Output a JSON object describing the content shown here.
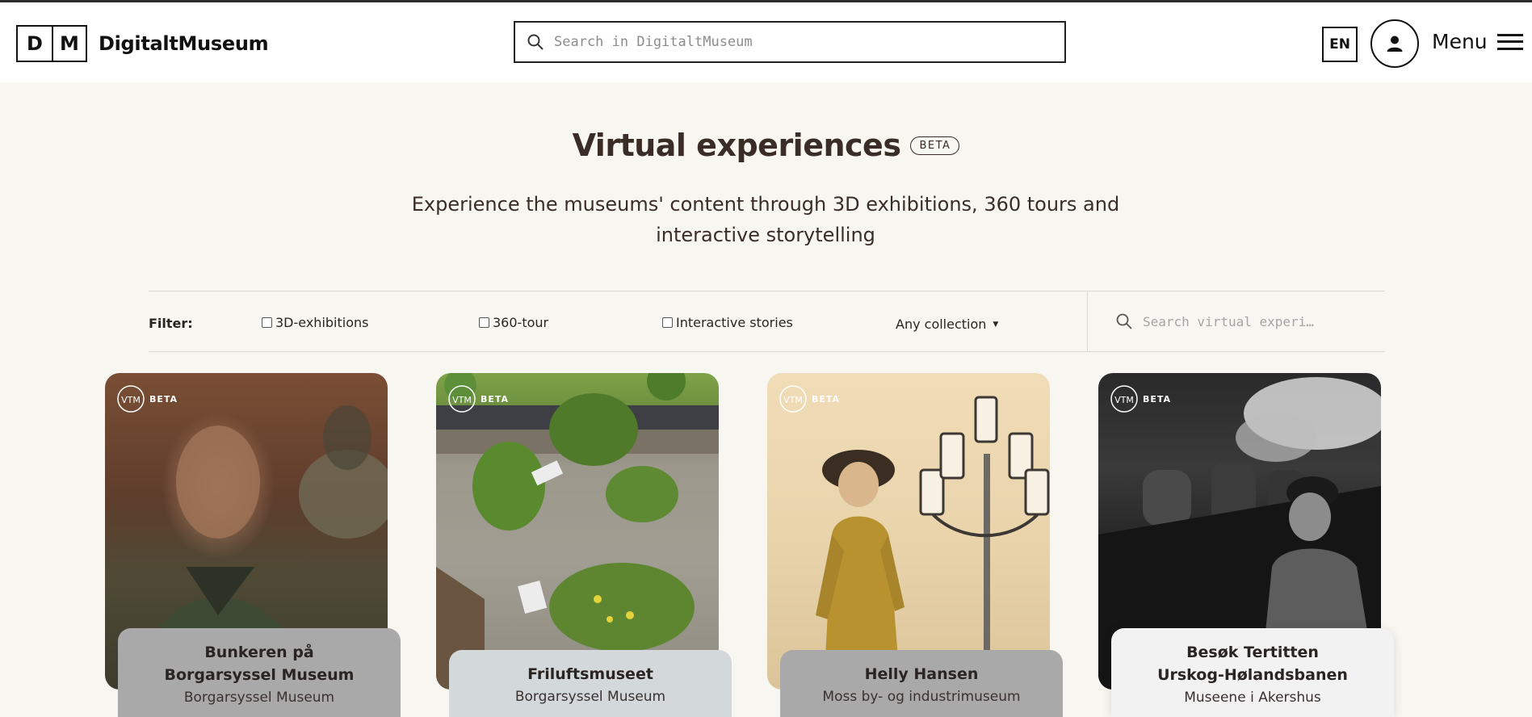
{
  "logo": {
    "letter1": "D",
    "letter2": "M",
    "name": "DigitaltMuseum"
  },
  "search": {
    "placeholder": "Search in DigitaltMuseum",
    "icon": "search-icon"
  },
  "header": {
    "lang": "EN",
    "menu_label": "Menu",
    "user_icon": "user-icon",
    "menu_icon": "hamburger-icon"
  },
  "hero": {
    "title": "Virtual experiences",
    "beta": "BETA",
    "subtitle": "Experience the museums' content through 3D exhibitions, 360 tours and interactive storytelling"
  },
  "filter": {
    "label": "Filter:",
    "options": [
      {
        "label": "3D-exhibitions",
        "checked": false
      },
      {
        "label": "360-tour",
        "checked": false
      },
      {
        "label": "Interactive stories",
        "checked": false
      }
    ],
    "collection": "Any collection",
    "search_placeholder": "Search virtual experi…"
  },
  "cards": [
    {
      "badge": "BETA",
      "title": "Bunkeren på Borgarsyssel Museum",
      "museum": "Borgarsyssel Museum"
    },
    {
      "badge": "BETA",
      "title": "Friluftsmuseet",
      "museum": "Borgarsyssel Museum"
    },
    {
      "badge": "BETA",
      "title": "Helly Hansen",
      "museum": "Moss by- og industrimuseum"
    },
    {
      "badge": "BETA",
      "title": "Besøk Tertitten Urskog-Hølandsbanen",
      "museum": "Museene i Akershus"
    }
  ],
  "colors": {
    "background": "#f8f6f1",
    "header": "#ffffff",
    "text": "#2a2522",
    "label_gray": "#a9a9a9",
    "label_blue_gray": "#d3d8da",
    "label_light": "#f2f2f2"
  }
}
